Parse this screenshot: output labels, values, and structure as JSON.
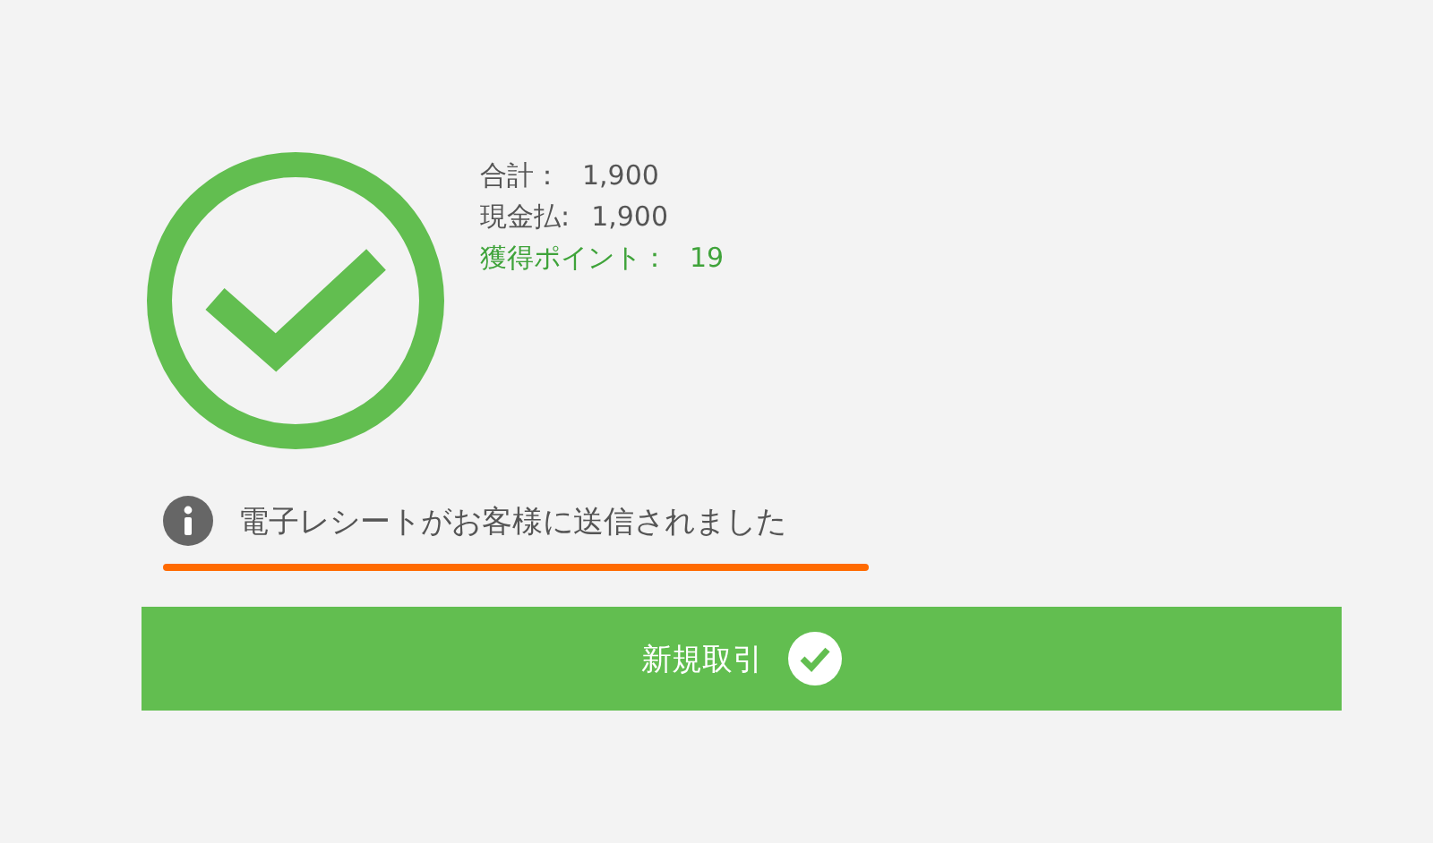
{
  "summary": [
    {
      "kind": "amount",
      "label": "合計：",
      "value": "1,900"
    },
    {
      "kind": "amount",
      "label": "現金払:",
      "value": "1,900"
    },
    {
      "kind": "points",
      "label": "獲得ポイント：",
      "value": "19"
    }
  ],
  "notice": {
    "text": "電子レシートがお客様に送信されました"
  },
  "button": {
    "label": "新規取引"
  }
}
